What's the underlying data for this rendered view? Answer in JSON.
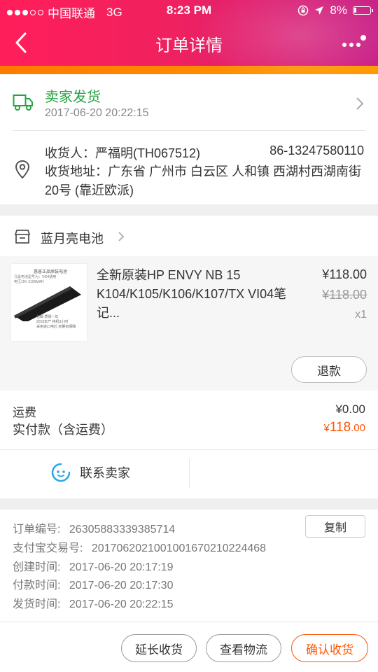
{
  "status_bar": {
    "carrier": "中国联通",
    "network": "3G",
    "time": "8:23 PM",
    "battery": "8%"
  },
  "nav": {
    "title": "订单详情"
  },
  "shipping": {
    "status": "卖家发货",
    "time": "2017-06-20 20:22:15"
  },
  "address": {
    "receiver": "收货人：严福明(TH067512)",
    "phone": "86-13247580110",
    "address": "收货地址：广东省 广州市 白云区 人和镇 西湖村西湖南街20号 (靠近欧派)"
  },
  "shop": {
    "name": "蓝月亮电池"
  },
  "item": {
    "title": "全新原装HP ENVY NB 15 K104/K105/K106/K107/TX VI04笔记...",
    "price": "¥118.00",
    "original_price": "¥118.00",
    "quantity": "x1",
    "refund_label": "退款",
    "thumb_lines": [
      "惠普正品原装电池",
      "凡是电池型号为：VI04通用",
      "电压15V 3100MAH",
      "包邮    质保一年",
      "2016年产  持机3小时",
      "采用进口电芯  容量有保障"
    ]
  },
  "fees": {
    "shipping_label": "运费",
    "shipping_value": "¥0.00",
    "paid_label": "实付款（含运费）",
    "paid_currency": "¥",
    "paid_main": "118",
    "paid_cents": ".00"
  },
  "contact": {
    "label": "联系卖家"
  },
  "order_info": {
    "copy_label": "复制",
    "rows": [
      {
        "label": "订单编号:",
        "value": "26305883339385714"
      },
      {
        "label": "支付宝交易号:",
        "value": "2017062021001001670210224468"
      },
      {
        "label": "创建时间:",
        "value": "2017-06-20 20:17:19"
      },
      {
        "label": "付款时间:",
        "value": "2017-06-20 20:17:30"
      },
      {
        "label": "发货时间:",
        "value": "2017-06-20 20:22:15"
      }
    ]
  },
  "actions": {
    "extend": "延长收货",
    "logistics": "查看物流",
    "confirm": "确认收货"
  },
  "colors": {
    "header_start": "#ff1e5a",
    "header_end": "#c81f86",
    "accent_orange": "#ff5500",
    "ship_green": "#27a342"
  }
}
